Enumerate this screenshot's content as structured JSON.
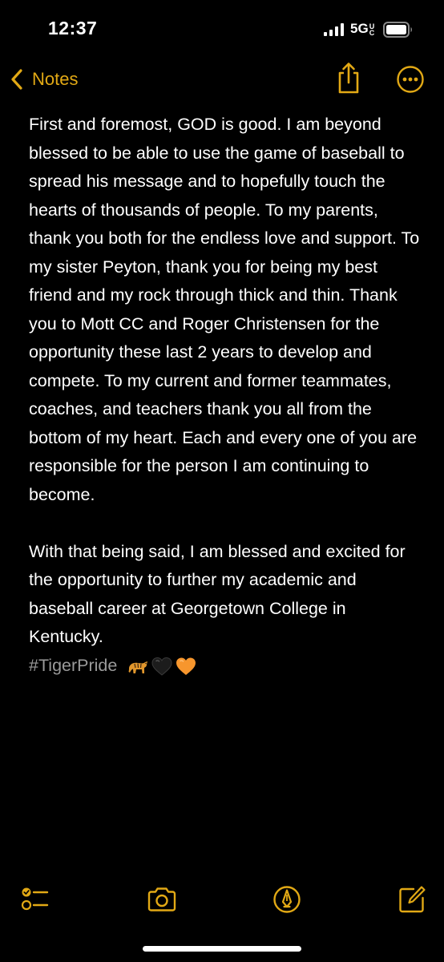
{
  "status_bar": {
    "time": "12:37",
    "network": "5G",
    "network_superscript": "UC"
  },
  "nav": {
    "back_label": "Notes"
  },
  "note": {
    "paragraph1": "First and foremost, GOD is good. I am beyond blessed to be able to use the game of baseball to spread his message and to hopefully touch the hearts of thousands of people. To my parents, thank you both for the endless love and support. To my sister Peyton, thank you for being my  best friend and my rock through thick and thin. Thank you to Mott CC and Roger Christensen for the opportunity these last 2 years to develop and compete. To my current and former teammates, coaches, and teachers thank you all from the bottom of my heart. Each and every one of you are responsible for the person I am continuing to become.",
    "paragraph2": "With that being said, I am blessed and excited for the opportunity to further my academic and baseball career at Georgetown College in Kentucky.",
    "hashtag": "#TigerPride",
    "emojis": [
      "tiger-emoji",
      "black-heart-emoji",
      "orange-heart-emoji"
    ]
  },
  "toolbar": {
    "items": [
      "checklist-icon",
      "camera-icon",
      "markup-icon",
      "compose-icon"
    ]
  },
  "colors": {
    "accent": "#e2a915",
    "background": "#000000",
    "text": "#ffffff",
    "hashtag": "#9a9a9a"
  }
}
